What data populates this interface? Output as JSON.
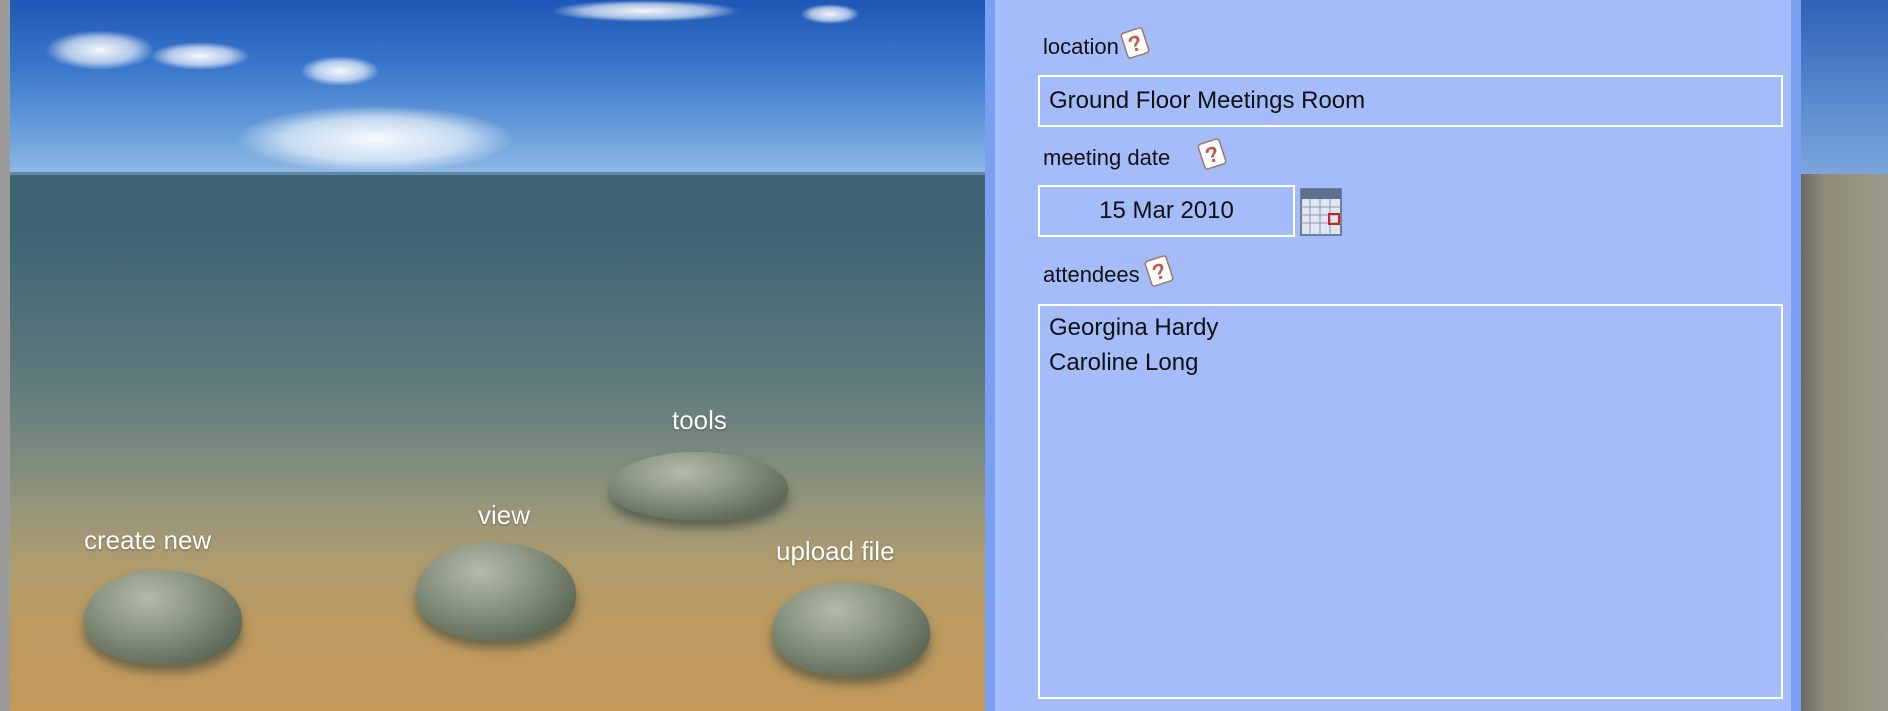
{
  "stones": {
    "create_new": "create new",
    "view": "view",
    "tools": "tools",
    "upload_file": "upload file"
  },
  "form": {
    "location_label": "location",
    "location_value": "Ground Floor Meetings Room",
    "meeting_date_label": "meeting date",
    "meeting_date_value": "15 Mar 2010",
    "attendees_label": "attendees",
    "attendees_value": "Georgina Hardy\nCaroline Long"
  },
  "colors": {
    "panel_bg": "#a4bcfa",
    "panel_border": "#7b9ff0",
    "field_border": "#ffffff",
    "label_text": "#111111",
    "stone_label_text": "#ffffff"
  },
  "icons": [
    "help-icon",
    "calendar-icon",
    "stone-button"
  ]
}
